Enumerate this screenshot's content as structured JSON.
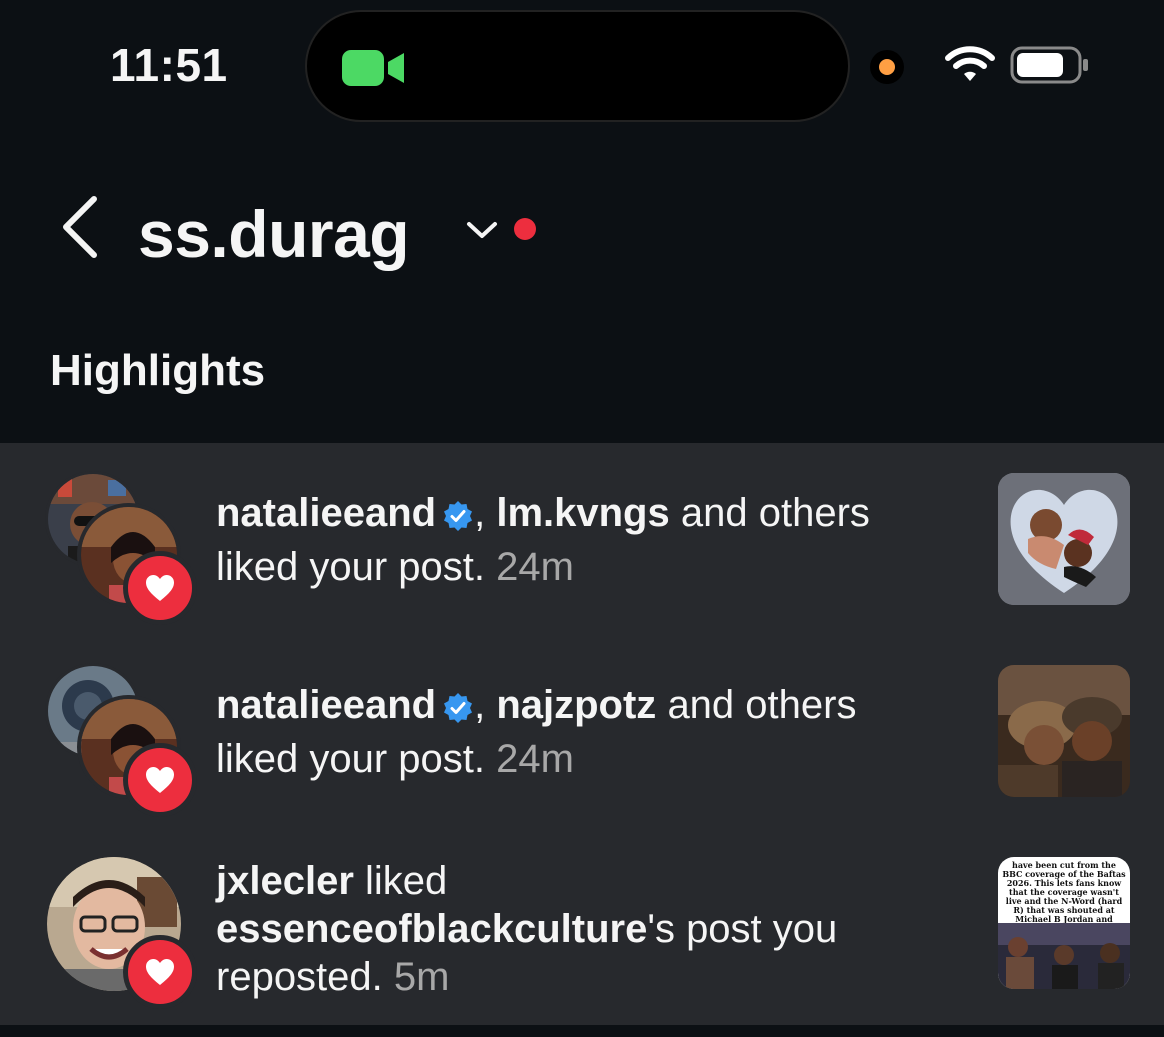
{
  "status_bar": {
    "time": "11:51",
    "icons": [
      "facetime-camera-icon",
      "mic-indicator-icon",
      "wifi-icon",
      "battery-icon"
    ],
    "colors": {
      "camera": "#4cd964",
      "mic_indicator": "#ff9f43"
    }
  },
  "header": {
    "back_icon": "chevron-left-icon",
    "username": "ss.durag",
    "dropdown_icon": "chevron-down-icon",
    "notification_dot_color": "#ed2e3e"
  },
  "section": {
    "title": "Highlights"
  },
  "notifications": [
    {
      "user1": "natalieeand",
      "verified": true,
      "separator": ",",
      "user2": "lm.kvngs",
      "rest": "and others",
      "action": "liked your post.",
      "time": "24m"
    },
    {
      "user1": "natalieeand",
      "verified": true,
      "separator": ",",
      "user2": "najzpotz",
      "rest": "and others",
      "action": "liked your post.",
      "time": "24m"
    },
    {
      "user1": "jxlecler",
      "mid": "liked",
      "owner": "essenceofblackculture",
      "action": "'s post you reposted.",
      "time": "5m",
      "thumb_text": "have been cut from the BBC coverage of the Baftas 2026. This lets fans know that the coverage wasn't live and the N-Word (hard R) that was shouted at Michael B Jordan and Delroy Lindo could've also been edited out, but wasn't."
    }
  ],
  "colors": {
    "background": "#0c1014",
    "list_background": "#27292d",
    "heart_badge": "#ed2e3e",
    "verified": "#3797f0",
    "muted_text": "#a8a8a8"
  }
}
